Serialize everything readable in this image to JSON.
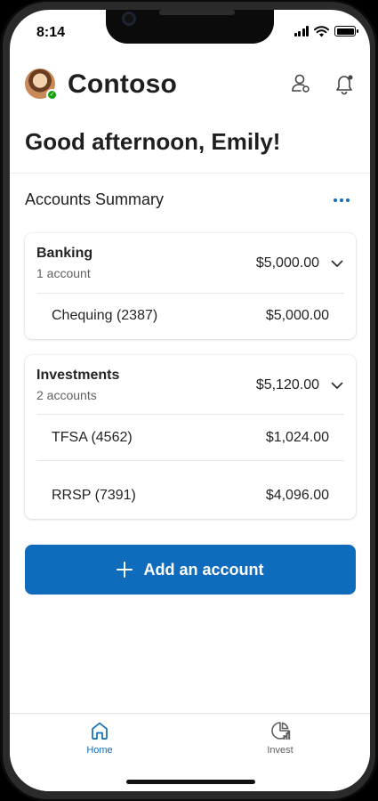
{
  "status": {
    "time": "8:14"
  },
  "header": {
    "app_name": "Contoso"
  },
  "greeting": "Good afternoon, Emily!",
  "summary": {
    "title": "Accounts Summary",
    "groups": [
      {
        "name": "Banking",
        "count": "1 account",
        "total": "$5,000.00",
        "accounts": [
          {
            "name": "Chequing (2387)",
            "amount": "$5,000.00"
          }
        ]
      },
      {
        "name": "Investments",
        "count": "2 accounts",
        "total": "$5,120.00",
        "accounts": [
          {
            "name": "TFSA (4562)",
            "amount": "$1,024.00"
          },
          {
            "name": "RRSP (7391)",
            "amount": "$4,096.00"
          }
        ]
      }
    ]
  },
  "actions": {
    "add_account": "Add an account"
  },
  "tabs": [
    {
      "label": "Home",
      "icon": "home-icon",
      "active": true
    },
    {
      "label": "Invest",
      "icon": "chart-icon",
      "active": false
    }
  ],
  "colors": {
    "accent": "#0f6cbd",
    "presence": "#13a10e",
    "text": "#1f1f1f",
    "muted": "#616161"
  }
}
